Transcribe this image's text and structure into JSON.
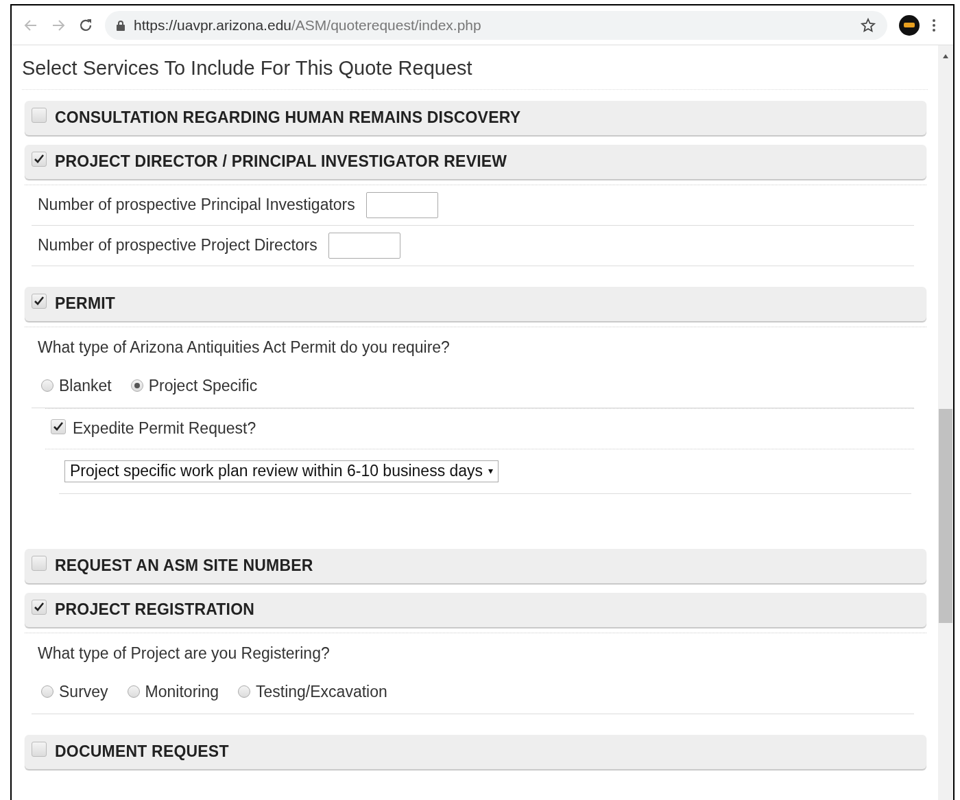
{
  "browser": {
    "url_host": "https://uavpr.arizona.edu",
    "url_path": "/ASM/quoterequest/index.php"
  },
  "heading": "Select Services To Include For This Quote Request",
  "sections": [
    {
      "title": "CONSULTATION REGARDING HUMAN REMAINS DISCOVERY",
      "checked": false
    },
    {
      "title": "PROJECT DIRECTOR / PRINCIPAL INVESTIGATOR REVIEW",
      "checked": true,
      "body": [
        {
          "kind": "number",
          "label": "Number of prospective Principal Investigators"
        },
        {
          "kind": "number",
          "label": "Number of prospective Project Directors"
        }
      ]
    },
    {
      "title": "PERMIT",
      "checked": true,
      "body": [
        {
          "kind": "question",
          "text": "What type of Arizona Antiquities Act Permit do you require?"
        },
        {
          "kind": "radios",
          "options": [
            {
              "label": "Blanket",
              "selected": false
            },
            {
              "label": "Project Specific",
              "selected": true
            }
          ]
        },
        {
          "kind": "checkbox",
          "label": "Expedite Permit Request?",
          "checked": true
        },
        {
          "kind": "select",
          "value": "Project specific work plan review within 6-10 business days",
          "caret": "▾"
        }
      ]
    },
    {
      "title": "REQUEST AN ASM SITE NUMBER",
      "checked": false
    },
    {
      "title": "PROJECT REGISTRATION",
      "checked": true,
      "body": [
        {
          "kind": "question",
          "text": "What type of Project are you Registering?"
        },
        {
          "kind": "radios",
          "options": [
            {
              "label": "Survey",
              "selected": false
            },
            {
              "label": "Monitoring",
              "selected": false
            },
            {
              "label": "Testing/Excavation",
              "selected": false
            }
          ]
        }
      ]
    },
    {
      "title": "DOCUMENT REQUEST",
      "checked": false
    }
  ]
}
